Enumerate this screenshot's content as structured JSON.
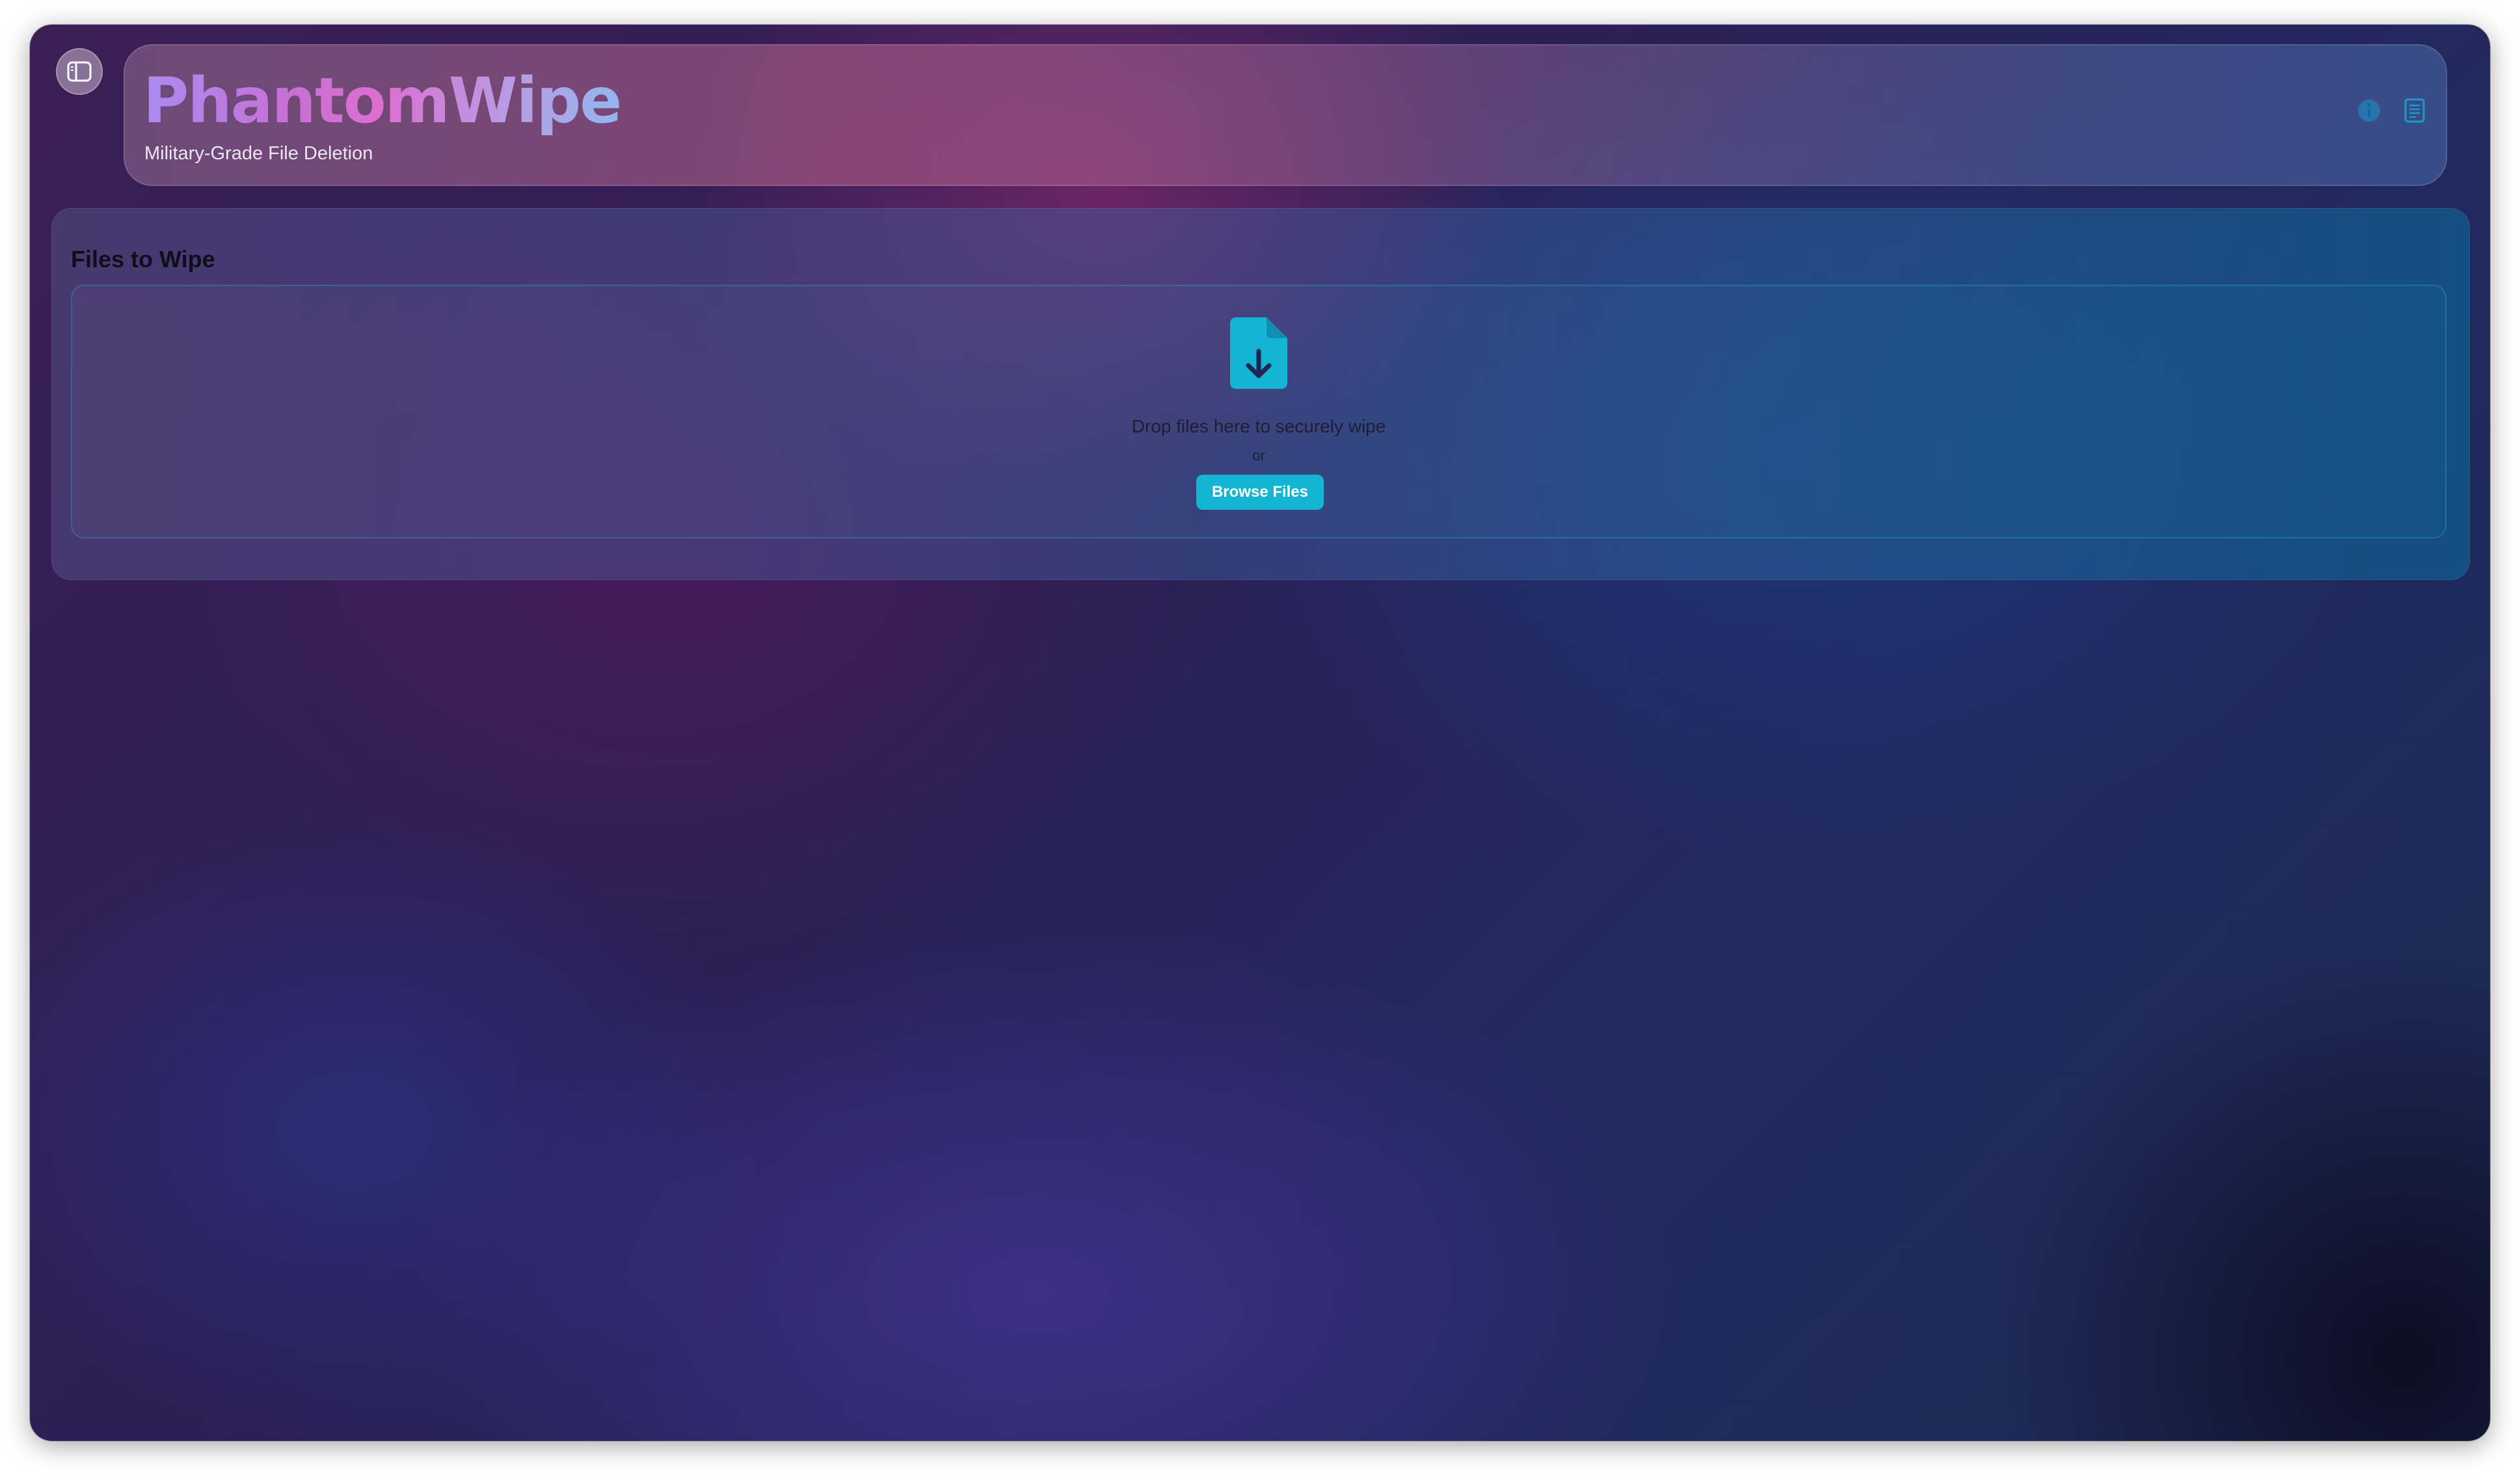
{
  "header": {
    "title": "PhantomWipe",
    "subtitle": "Military-Grade File Deletion",
    "icons": [
      "info-icon",
      "document-list-icon"
    ]
  },
  "sidebar_toggle": {
    "icon": "sidebar-toggle-icon"
  },
  "files_panel": {
    "title": "Files to Wipe",
    "dropzone": {
      "icon": "file-download-icon",
      "prompt": "Drop files here to securely wipe",
      "or_label": "or",
      "browse_label": "Browse Files"
    }
  },
  "colors": {
    "accent": "#14b4d4",
    "title_gradient": [
      "#a98cf0",
      "#dd6fcf",
      "#93b6f0"
    ]
  }
}
